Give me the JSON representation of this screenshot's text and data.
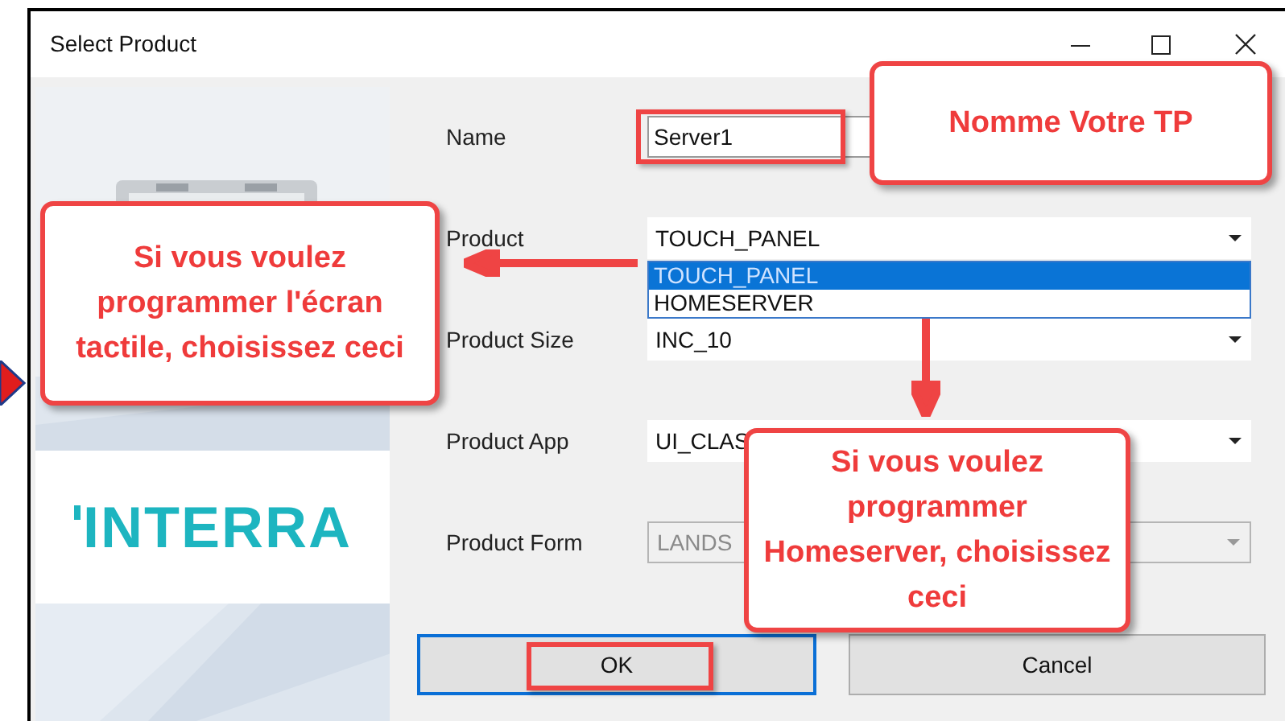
{
  "window": {
    "title": "Select Product"
  },
  "logo": "INTERRA",
  "fields": [
    {
      "kind": "text",
      "label": "Name",
      "value": "Server1",
      "highlighted": true
    },
    {
      "kind": "select",
      "label": "Product",
      "value": "TOUCH_PANEL",
      "expanded": true,
      "disabled": false,
      "options": [
        {
          "label": "TOUCH_PANEL",
          "selected": true
        },
        {
          "label": "HOMESERVER",
          "selected": false
        }
      ]
    },
    {
      "kind": "select",
      "label": "Product Size",
      "value": "INC_10",
      "disabled": false
    },
    {
      "kind": "select",
      "label": "Product App",
      "value": "UI_CLAS",
      "disabled": false
    },
    {
      "kind": "select",
      "label": "Product Form",
      "value": "LANDS",
      "disabled": true
    }
  ],
  "buttons": [
    {
      "label": "OK",
      "focused": true,
      "highlighted": true
    },
    {
      "label": "Cancel",
      "focused": false,
      "highlighted": false
    }
  ],
  "annotations": [
    {
      "text": "Nomme Votre TP"
    },
    {
      "text": "Si vous voulez programmer l'écran tactile, choisissez ceci"
    },
    {
      "text": "Si vous voulez programmer Homeserver, choisissez ceci"
    }
  ]
}
